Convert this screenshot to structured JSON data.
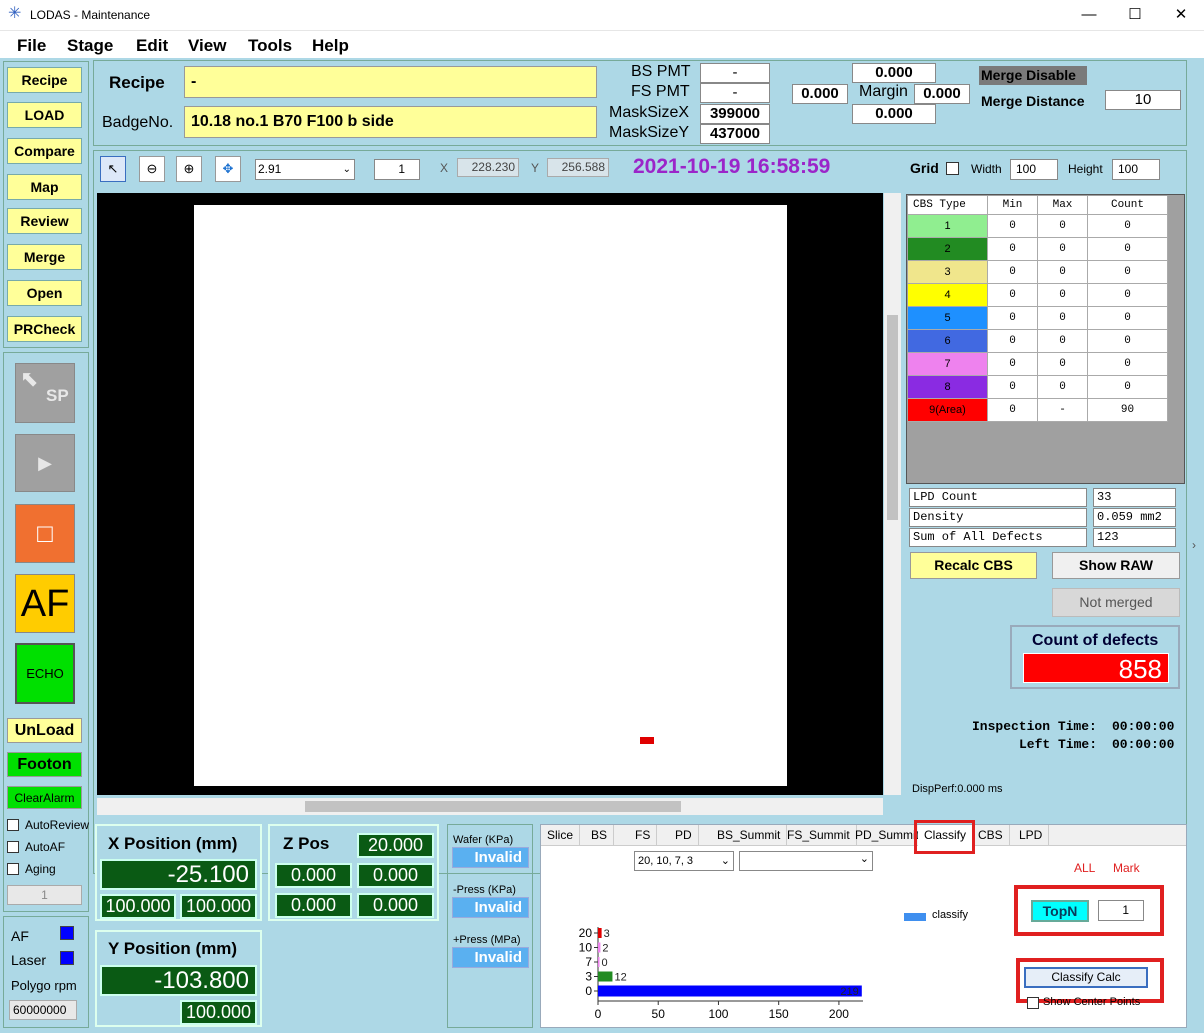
{
  "window": {
    "title": "LODAS - Maintenance",
    "minimize": "—",
    "maximize": "☐",
    "close": "✕"
  },
  "menu": [
    "File",
    "Stage",
    "Edit",
    "View",
    "Tools",
    "Help"
  ],
  "left_buttons": [
    "Recipe",
    "LOAD",
    "Compare",
    "Map",
    "Review",
    "Merge",
    "Open",
    "PRCheck"
  ],
  "ctrl": {
    "sp": "SP",
    "play": "▶",
    "stop": "□",
    "af": "AF",
    "echo": "ECHO",
    "unload": "UnLoad",
    "footon": "Footon",
    "clearalarm": "ClearAlarm",
    "autoreview": "AutoReview",
    "autoaf": "AutoAF",
    "aging": "Aging",
    "aging_value": "1",
    "af_ind": "AF",
    "laser_ind": "Laser",
    "polygo": "Polygo rpm",
    "polygo_value": "60000000"
  },
  "header": {
    "recipe_label": "Recipe",
    "recipe_value": "-",
    "badge_label": "BadgeNo.",
    "badge_value": "10.18 no.1 B70 F100 b side",
    "bs_pmt_label": "BS PMT",
    "bs_pmt_value": "-",
    "fs_pmt_label": "FS PMT",
    "fs_pmt_value": "-",
    "masksizex_label": "MaskSizeX",
    "masksizex_value": "399000",
    "masksizey_label": "MaskSizeY",
    "masksizey_value": "437000",
    "val1": "0.000",
    "val2": "0.000",
    "margin_label": "Margin",
    "margin_value": "0.000",
    "val3": "0.000",
    "merge_disable": "Merge Disable",
    "merge_distance_label": "Merge Distance",
    "merge_distance_value": "10"
  },
  "toolbar": {
    "zoom": "2.91",
    "step": "1",
    "x_label": "X",
    "x_value": "228.230",
    "y_label": "Y",
    "y_value": "256.588",
    "datetime": "2021-10-19 16:58:59",
    "grid_label": "Grid",
    "width_label": "Width",
    "width_value": "100",
    "height_label": "Height",
    "height_value": "100"
  },
  "cbs_table": {
    "headers": [
      "CBS Type",
      "Min",
      "Max",
      "Count"
    ],
    "rows": [
      {
        "type": "1",
        "min": "0",
        "max": "0",
        "count": "0",
        "color": "#90ee90"
      },
      {
        "type": "2",
        "min": "0",
        "max": "0",
        "count": "0",
        "color": "#228b22"
      },
      {
        "type": "3",
        "min": "0",
        "max": "0",
        "count": "0",
        "color": "#f0e68c"
      },
      {
        "type": "4",
        "min": "0",
        "max": "0",
        "count": "0",
        "color": "#ffff00"
      },
      {
        "type": "5",
        "min": "0",
        "max": "0",
        "count": "0",
        "color": "#1e90ff"
      },
      {
        "type": "6",
        "min": "0",
        "max": "0",
        "count": "0",
        "color": "#4169e1"
      },
      {
        "type": "7",
        "min": "0",
        "max": "0",
        "count": "0",
        "color": "#ee82ee"
      },
      {
        "type": "8",
        "min": "0",
        "max": "0",
        "count": "0",
        "color": "#8a2be2"
      },
      {
        "type": "9(Area)",
        "min": "0",
        "max": "-",
        "count": "90",
        "color": "#ff0000"
      }
    ]
  },
  "stats": {
    "lpd_label": "LPD Count",
    "lpd_value": "33",
    "density_label": "Density",
    "density_value": "0.059 mm2",
    "sum_label": "Sum of All Defects",
    "sum_value": "123"
  },
  "buttons": {
    "recalc": "Recalc CBS",
    "showraw": "Show RAW",
    "notmerged": "Not merged"
  },
  "defects": {
    "label": "Count of defects",
    "value": "858"
  },
  "times": {
    "insp_label": "Inspection Time:",
    "insp_value": "00:00:00",
    "left_label": "Left Time:",
    "left_value": "00:00:00",
    "dispperf": "DispPerf:0.000 ms"
  },
  "xpos": {
    "label": "X Position (mm)",
    "value": "-25.100",
    "a": "100.000",
    "b": "100.000"
  },
  "ypos": {
    "label": "Y Position (mm)",
    "value": "-103.800",
    "a": "100.000"
  },
  "zpos": {
    "label": "Z Pos",
    "value": "20.000",
    "a": "0.000",
    "b": "0.000",
    "c": "0.000",
    "d": "0.000"
  },
  "pressure": {
    "wafer_label": "Wafer (KPa)",
    "wafer": "Invalid",
    "minus_label": "-Press (KPa)",
    "minus": "Invalid",
    "plus_label": "+Press (MPa)",
    "plus": "Invalid"
  },
  "tabs": [
    "Slice",
    "BS",
    "FS",
    "PD",
    "BS_Summit",
    "FS_Summit",
    "PD_Summit",
    "Classify",
    "CBS",
    "LPD"
  ],
  "classify": {
    "combo": "20, 10, 7, 3",
    "all": "ALL",
    "mark": "Mark",
    "topn": "TopN",
    "topn_value": "1",
    "calc": "Classify Calc",
    "show_center": "Show Center Points",
    "legend": "classify"
  },
  "colors": {
    "bg": "#add8e6",
    "yellow": "#ffff99",
    "dark_green": "#0a5a14",
    "highlight": "#e02020"
  },
  "chart_data": {
    "type": "bar",
    "orientation": "horizontal",
    "categories": [
      "20",
      "10",
      "7",
      "3",
      "0"
    ],
    "values": [
      3,
      2,
      0,
      12,
      219
    ],
    "colors": [
      "#e00000",
      "#ee82ee",
      "#ee82ee",
      "#228b22",
      "#0000ff"
    ],
    "xticks": [
      "0",
      "50",
      "100",
      "150",
      "200"
    ],
    "xlim": [
      0,
      220
    ],
    "legend": "classify"
  }
}
